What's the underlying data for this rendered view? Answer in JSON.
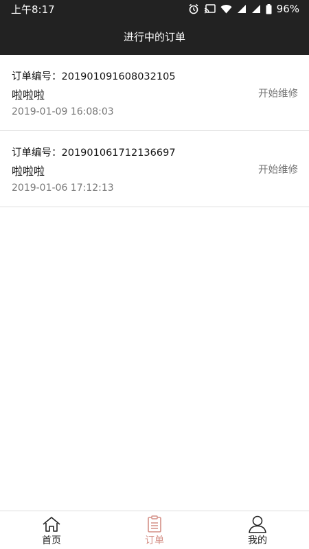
{
  "status_bar": {
    "time": "上午8:17",
    "battery": "96%"
  },
  "header": {
    "title": "进行中的订单"
  },
  "orders": [
    {
      "no_label": "订单编号：201901091608032105",
      "title": "啦啦啦",
      "status": "开始维修",
      "time": "2019-01-09 16:08:03"
    },
    {
      "no_label": "订单编号：201901061712136697",
      "title": "啦啦啦",
      "status": "开始维修",
      "time": "2019-01-06 17:12:13"
    }
  ],
  "tabs": [
    {
      "label": "首页",
      "icon": "home-icon"
    },
    {
      "label": "订单",
      "icon": "clipboard-icon",
      "active": true
    },
    {
      "label": "我的",
      "icon": "user-icon"
    }
  ],
  "colors": {
    "header_bg": "#222222",
    "active_tab": "#d48f86",
    "muted_text": "#777777"
  }
}
